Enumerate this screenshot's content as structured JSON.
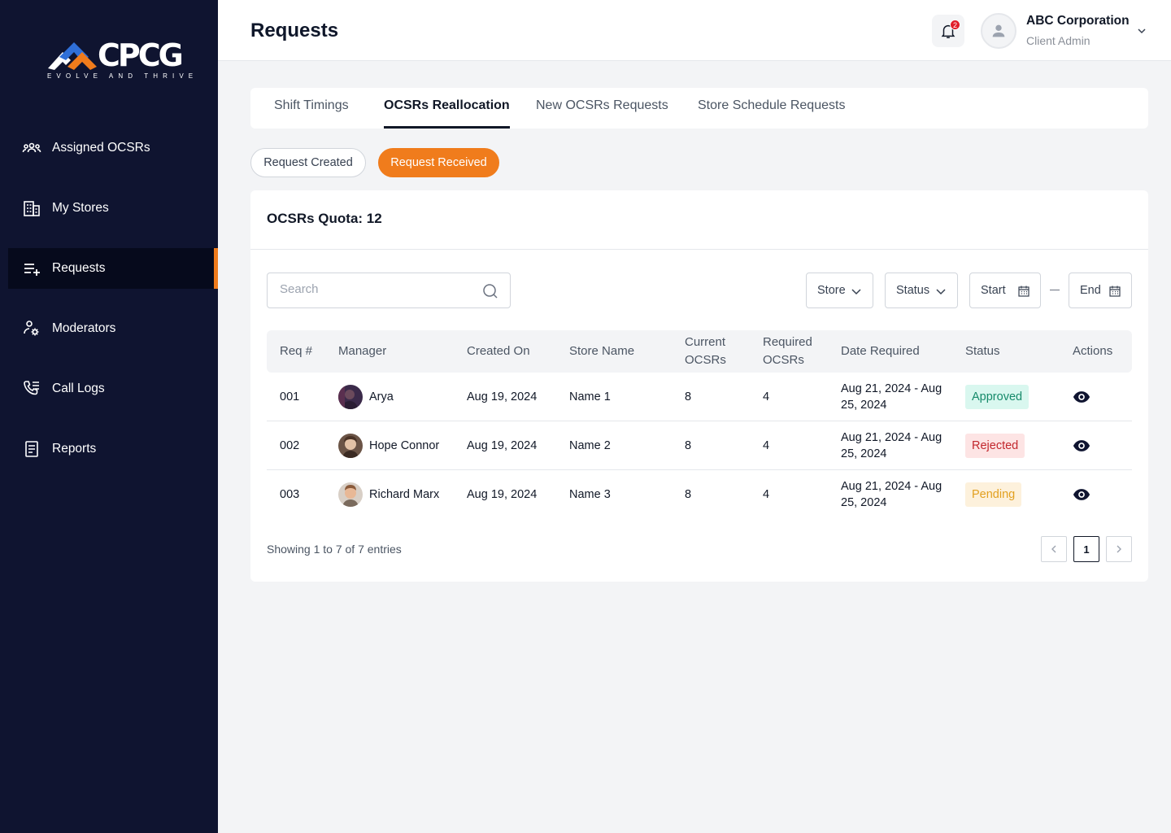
{
  "brand": {
    "logo_text": "CPCG",
    "tagline": "EVOLVE AND THRIVE",
    "accent_color": "#f07c1c",
    "sidebar_bg": "#0f1430"
  },
  "sidebar": {
    "items": [
      {
        "label": "Assigned OCSRs",
        "icon": "users-icon",
        "active": false
      },
      {
        "label": "My Stores",
        "icon": "building-icon",
        "active": false
      },
      {
        "label": "Requests",
        "icon": "list-add-icon",
        "active": true
      },
      {
        "label": "Moderators",
        "icon": "user-settings-icon",
        "active": false
      },
      {
        "label": "Call Logs",
        "icon": "phone-log-icon",
        "active": false
      },
      {
        "label": "Reports",
        "icon": "report-icon",
        "active": false
      }
    ]
  },
  "header": {
    "title": "Requests",
    "notification_count": "2",
    "user": {
      "name": "ABC Corporation",
      "role": "Client Admin"
    }
  },
  "tabs": [
    {
      "label": "Shift Timings",
      "active": false
    },
    {
      "label": "OCSRs Reallocation",
      "active": true
    },
    {
      "label": "New OCSRs Requests",
      "active": false
    },
    {
      "label": "Store Schedule Requests",
      "active": false
    }
  ],
  "subtabs": [
    {
      "label": "Request Created",
      "active": false
    },
    {
      "label": "Request Received",
      "active": true
    }
  ],
  "card": {
    "quota": "OCSRs Quota: 12",
    "search_placeholder": "Search",
    "filters": {
      "store": "Store",
      "status": "Status",
      "start": "Start",
      "end": "End"
    }
  },
  "table": {
    "columns": [
      "Req #",
      "Manager",
      "Created On",
      "Store Name",
      "Current OCSRs",
      "Required OCSRs",
      "Date Required",
      "Status",
      "Actions"
    ],
    "rows": [
      {
        "req": "001",
        "manager": "Arya",
        "created_on": "Aug 19, 2024",
        "store": "Name 1",
        "current": "8",
        "required": "4",
        "date_required": "Aug 21, 2024 - Aug 25, 2024",
        "status": "Approved",
        "status_type": "approved"
      },
      {
        "req": "002",
        "manager": "Hope Connor",
        "created_on": "Aug 19, 2024",
        "store": "Name 2",
        "current": "8",
        "required": "4",
        "date_required": "Aug 21, 2024 - Aug 25, 2024",
        "status": "Rejected",
        "status_type": "rejected"
      },
      {
        "req": "003",
        "manager": "Richard Marx",
        "created_on": "Aug 19, 2024",
        "store": "Name 3",
        "current": "8",
        "required": "4",
        "date_required": "Aug 21, 2024 - Aug 25, 2024",
        "status": "Pending",
        "status_type": "pending"
      }
    ]
  },
  "pagination": {
    "summary": "Showing 1 to 7 of 7 entries",
    "current_page": "1"
  }
}
